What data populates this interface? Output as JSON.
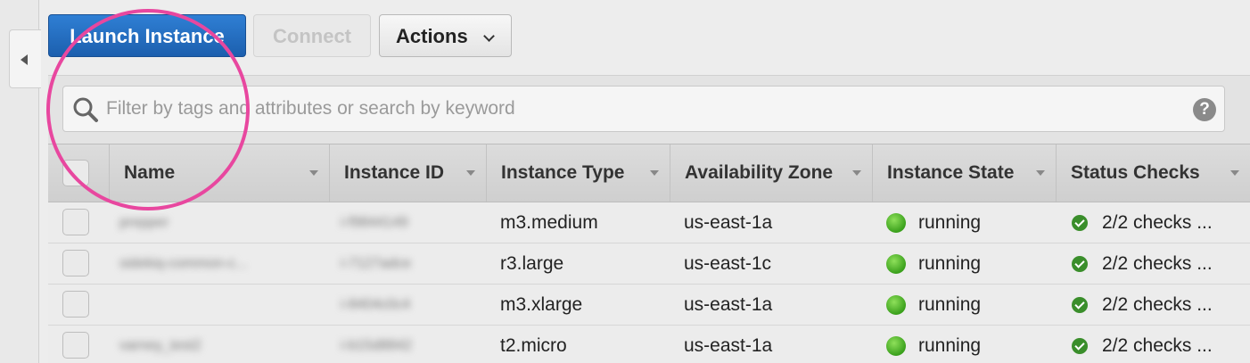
{
  "toolbar": {
    "launch_label": "Launch Instance",
    "connect_label": "Connect",
    "actions_label": "Actions"
  },
  "search": {
    "placeholder": "Filter by tags and attributes or search by keyword",
    "value": "",
    "help_label": "?"
  },
  "table": {
    "columns": [
      "Name",
      "Instance ID",
      "Instance Type",
      "Availability Zone",
      "Instance State",
      "Status Checks"
    ],
    "rows": [
      {
        "name": "prepper",
        "instance_id": "i-f9844149",
        "instance_type": "m3.medium",
        "zone": "us-east-1a",
        "state": "running",
        "status": "2/2 checks ..."
      },
      {
        "name": "sidekiq-common-c...",
        "instance_id": "i-7127adce",
        "instance_type": "r3.large",
        "zone": "us-east-1c",
        "state": "running",
        "status": "2/2 checks ..."
      },
      {
        "name": "",
        "instance_id": "i-8404c0c4",
        "instance_type": "m3.xlarge",
        "zone": "us-east-1a",
        "state": "running",
        "status": "2/2 checks ..."
      },
      {
        "name": "varney_test2",
        "instance_id": "i-b15d8842",
        "instance_type": "t2.micro",
        "zone": "us-east-1a",
        "state": "running",
        "status": "2/2 checks ..."
      }
    ]
  },
  "colors": {
    "primary": "#1c5fae",
    "running": "#3aa01c",
    "highlight": "#e8479f"
  }
}
